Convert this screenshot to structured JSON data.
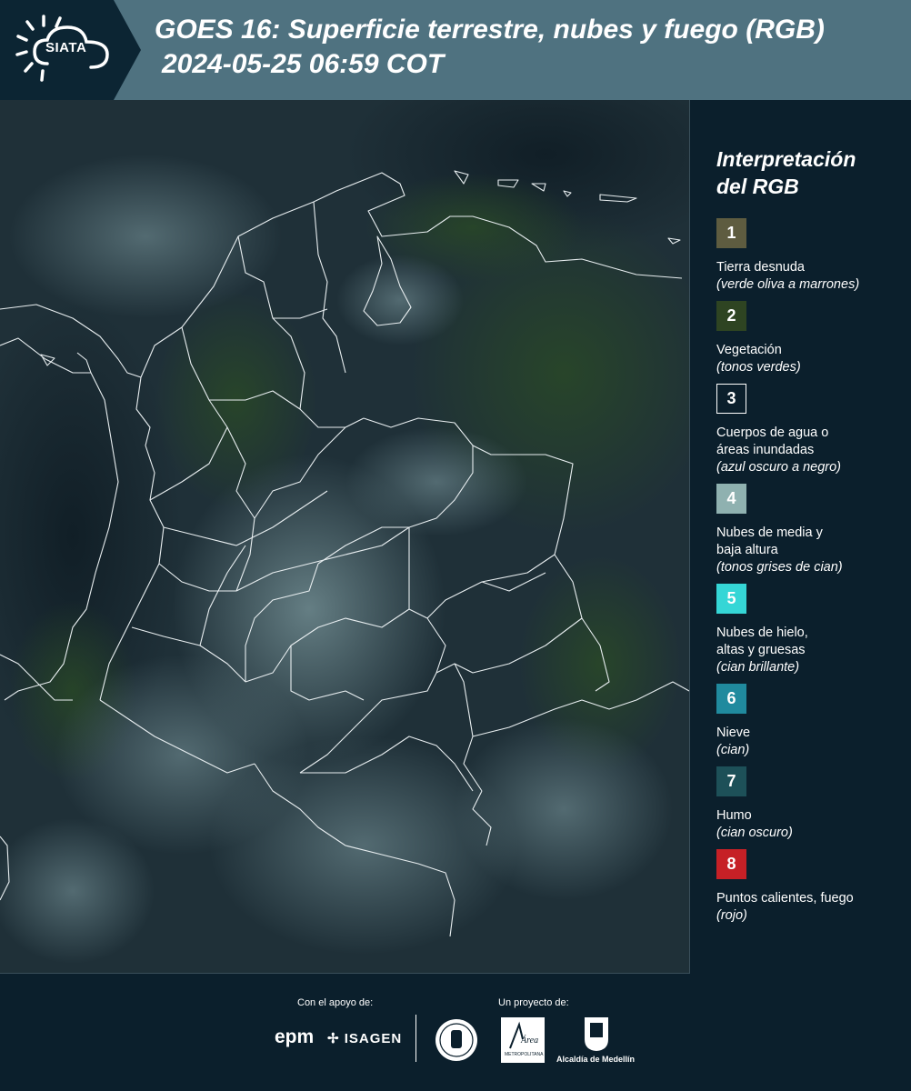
{
  "header": {
    "logo_text": "SIATA",
    "title_line1": "GOES 16: Superficie terrestre, nubes y fuego (RGB)",
    "title_line2": "2024-05-25 06:59 COT"
  },
  "legend": {
    "title_line1": "Interpretación",
    "title_line2": "del RGB",
    "items": [
      {
        "number": "1",
        "label_lines": [
          "Tierra desnuda"
        ],
        "desc": "(verde oliva a marrones)",
        "color": "#5e5c40"
      },
      {
        "number": "2",
        "label_lines": [
          "Vegetación"
        ],
        "desc": "(tonos verdes)",
        "color": "#2e4422"
      },
      {
        "number": "3",
        "label_lines": [
          "Cuerpos de agua o",
          "áreas inundadas"
        ],
        "desc": "(azul oscuro a negro)",
        "color": "#0b1f2c"
      },
      {
        "number": "4",
        "label_lines": [
          "Nubes de media y",
          "baja altura"
        ],
        "desc": "(tonos grises de cian)",
        "color": "#8fb1b0"
      },
      {
        "number": "5",
        "label_lines": [
          "Nubes de hielo,",
          "altas y gruesas"
        ],
        "desc": "(cian brillante)",
        "color": "#35d6d6"
      },
      {
        "number": "6",
        "label_lines": [
          "Nieve"
        ],
        "desc": "(cian)",
        "color": "#208a9e"
      },
      {
        "number": "7",
        "label_lines": [
          "Humo"
        ],
        "desc": "(cian oscuro)",
        "color": "#1d5058"
      },
      {
        "number": "8",
        "label_lines": [
          "Puntos calientes, fuego"
        ],
        "desc": "(rojo)",
        "color": "#c62026"
      }
    ]
  },
  "footer": {
    "support_label": "Con el apoyo de:",
    "project_label": "Un proyecto de:",
    "sponsor1": "epm",
    "sponsor2": "ISAGEN",
    "partner_area": "Área",
    "partner_area_sub": "METROPOLITANA",
    "partner_alcaldia": "Alcaldía de Medellín"
  }
}
